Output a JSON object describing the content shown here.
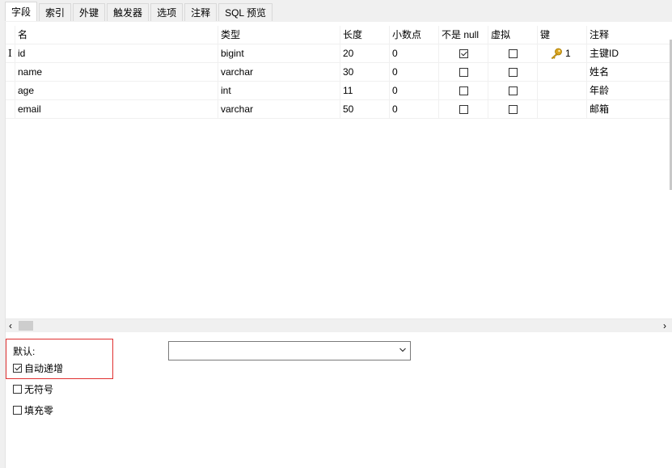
{
  "tabs": [
    "字段",
    "索引",
    "外键",
    "触发器",
    "选项",
    "注释",
    "SQL 预览"
  ],
  "active_tab": "字段",
  "columns": [
    "名",
    "类型",
    "长度",
    "小数点",
    "不是 null",
    "虚拟",
    "键",
    "注释"
  ],
  "rows": [
    {
      "name": "id",
      "type": "bigint",
      "length": "20",
      "decimals": "0",
      "not_null": true,
      "virtual": false,
      "key": "1",
      "comment": "主键ID"
    },
    {
      "name": "name",
      "type": "varchar",
      "length": "30",
      "decimals": "0",
      "not_null": false,
      "virtual": false,
      "key": "",
      "comment": "姓名"
    },
    {
      "name": "age",
      "type": "int",
      "length": "11",
      "decimals": "0",
      "not_null": false,
      "virtual": false,
      "key": "",
      "comment": "年龄"
    },
    {
      "name": "email",
      "type": "varchar",
      "length": "50",
      "decimals": "0",
      "not_null": false,
      "virtual": false,
      "key": "",
      "comment": "邮箱"
    }
  ],
  "properties": {
    "default_label": "默认:",
    "default_value": "",
    "auto_increment_label": "自动递增",
    "auto_increment": true,
    "unsigned_label": "无符号",
    "unsigned": false,
    "zerofill_label": "填充零",
    "zerofill": false
  },
  "icons": {
    "row_cursor": "i-beam-cursor-icon",
    "key": "key-icon",
    "scroll_left": "chevron-left-icon",
    "scroll_right": "chevron-right-icon",
    "dropdown": "chevron-down-icon"
  },
  "colors": {
    "highlight_border": "#e03030",
    "key_icon": "#d9a520"
  }
}
